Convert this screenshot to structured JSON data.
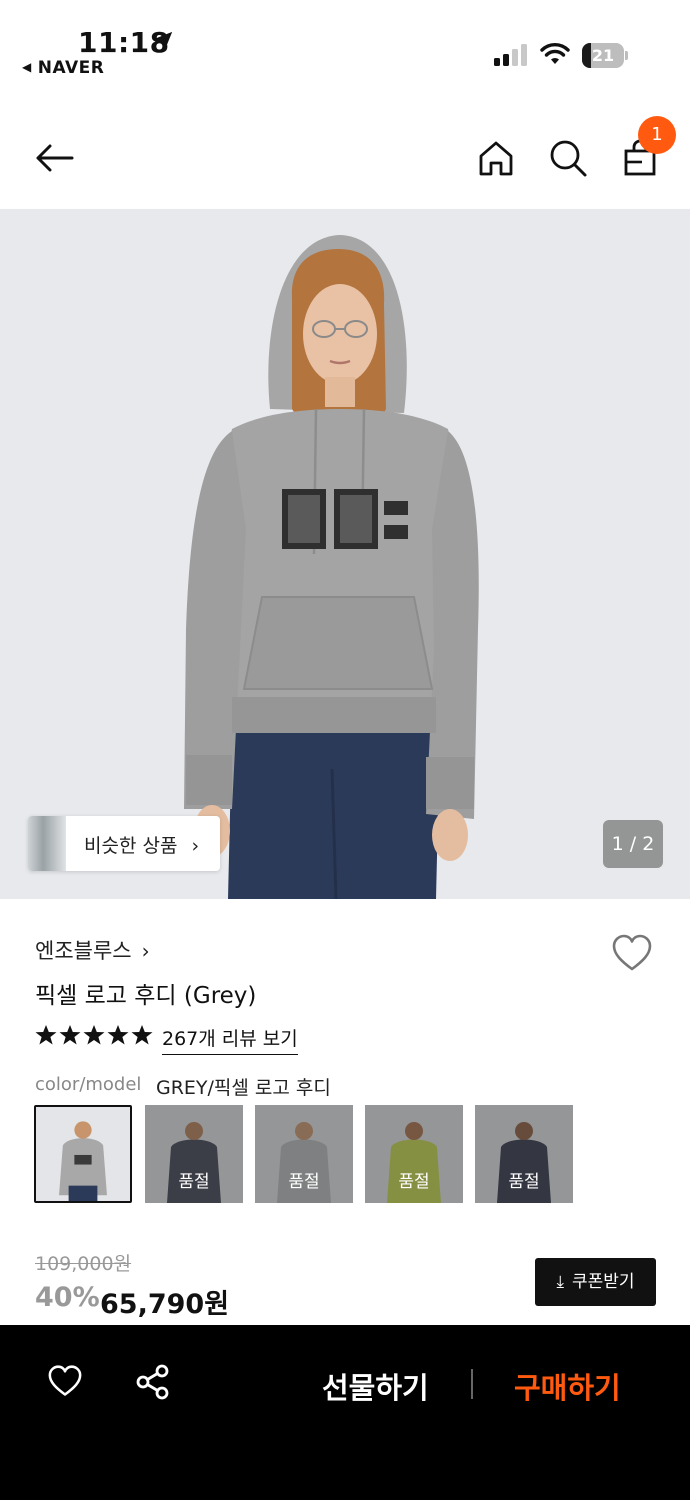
{
  "status_bar": {
    "time": "11:18",
    "back_app": "NAVER",
    "battery": "21",
    "battery_level": 0.21
  },
  "header": {
    "cart_count": "1",
    "accent_color": "#ff5a0f"
  },
  "gallery": {
    "similar_label": "비슷한 상품",
    "page_indicator": "1 / 2"
  },
  "product": {
    "brand": "엔조블루스",
    "title": "픽셀 로고 후디 (Grey)",
    "rating_stars": 5,
    "review_link": "267개 리뷰 보기",
    "option_label": "color/model",
    "option_value": "GREY/픽셀 로고 후디",
    "swatches": [
      {
        "color": "#c7c7c7",
        "soldout": ""
      },
      {
        "color": "#3c4150",
        "soldout": "품절"
      },
      {
        "color": "#b6b9bb",
        "soldout": "품절"
      },
      {
        "color": "#c3d54a",
        "soldout": "품절"
      },
      {
        "color": "#2f3448",
        "soldout": "품절"
      }
    ],
    "original_price": "109,000원",
    "discount": "40%",
    "sale_price": "65,790원",
    "coupon_button": "쿠폰받기"
  },
  "bottom_bar": {
    "gift_button": "선물하기",
    "buy_button": "구매하기"
  }
}
